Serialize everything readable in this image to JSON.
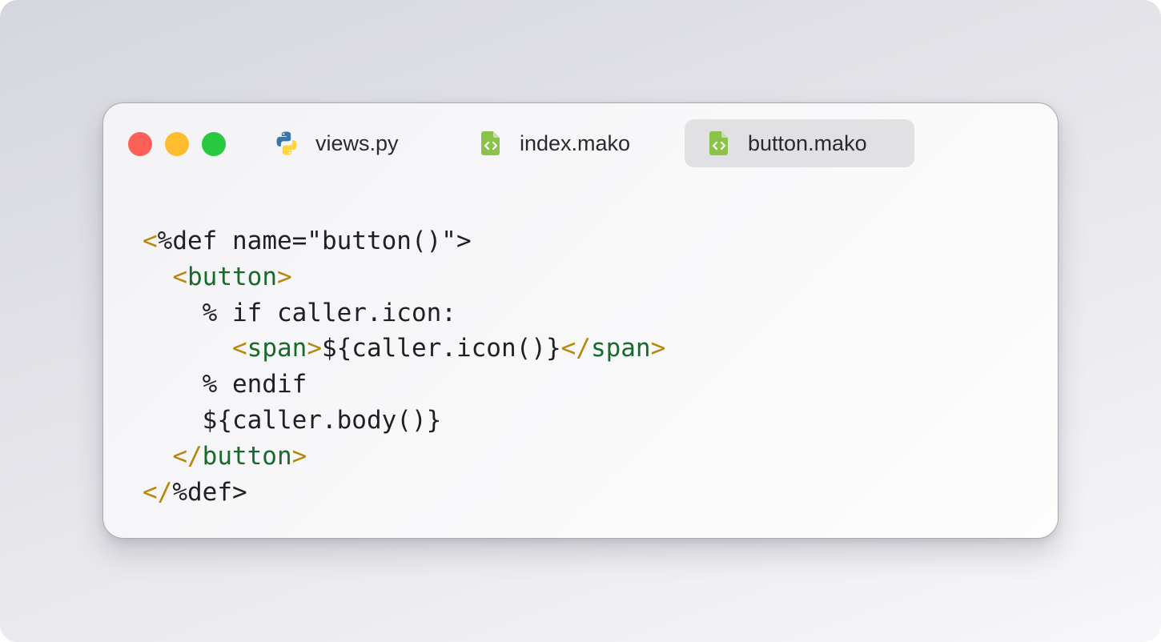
{
  "window": {
    "tabs": [
      {
        "label": "views.py",
        "icon": "python-icon",
        "active": false
      },
      {
        "label": "index.mako",
        "icon": "code-file-icon",
        "active": false
      },
      {
        "label": "button.mako",
        "icon": "code-file-icon",
        "active": true
      }
    ]
  },
  "colors": {
    "punctuation": "#b8860b",
    "tag": "#19692c",
    "text": "#1f1f24",
    "file_icon": "#8bc34a",
    "python_blue": "#3776ab",
    "python_yellow": "#ffd43b"
  },
  "code": {
    "lines": [
      [
        "<",
        "%def name=\"button()\">"
      ],
      [
        "  ",
        "<",
        "button",
        ">"
      ],
      [
        "    % if caller.icon:"
      ],
      [
        "      ",
        "<",
        "span",
        ">",
        "${caller.icon()}",
        "</",
        "span",
        ">"
      ],
      [
        "    % endif"
      ],
      [
        "    ${caller.body()}"
      ],
      [
        "  ",
        "</",
        "button",
        ">"
      ],
      [
        "</",
        "%def>"
      ]
    ]
  }
}
